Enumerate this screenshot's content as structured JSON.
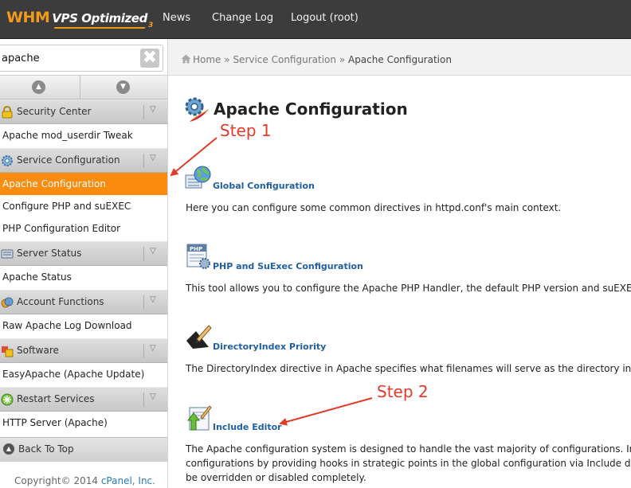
{
  "header": {
    "logo": {
      "whm": "WHM",
      "vps": "VPS Optimized",
      "version": "3"
    },
    "nav": [
      "News",
      "Change Log",
      "Logout (root)"
    ]
  },
  "sidebar": {
    "search_value": "apache",
    "clear_glyph": "✖",
    "groups": [
      {
        "category": "Security Center",
        "icon": "padlock-icon",
        "items": [
          "Apache mod_userdir Tweak"
        ]
      },
      {
        "category": "Service Configuration",
        "icon": "gear-icon",
        "items": [
          "Apache Configuration",
          "Configure PHP and suEXEC",
          "PHP Configuration Editor"
        ]
      },
      {
        "category": "Server Status",
        "icon": "server-icon",
        "items": [
          "Apache Status"
        ]
      },
      {
        "category": "Account Functions",
        "icon": "accounts-icon",
        "items": [
          "Raw Apache Log Download"
        ]
      },
      {
        "category": "Software",
        "icon": "software-icon",
        "items": [
          "EasyApache (Apache Update)"
        ]
      },
      {
        "category": "Restart Services",
        "icon": "restart-icon",
        "items": [
          "HTTP Server (Apache)"
        ]
      }
    ],
    "active_item": "Apache Configuration",
    "back_to_top": "Back To Top",
    "copyright_text": "Copyright© 2014 ",
    "copyright_link": "cPanel, Inc."
  },
  "breadcrumb": {
    "home": "Home",
    "sep": "»",
    "section": "Service Configuration",
    "current": "Apache Configuration"
  },
  "main": {
    "title": "Apache Configuration",
    "sections": [
      {
        "title": "Global Configuration",
        "icon": "globe-config-icon",
        "desc": [
          "Here you can configure some common directives in httpd.conf's main context."
        ]
      },
      {
        "title": "PHP and SuExec Configuration",
        "icon": "php-icon",
        "desc": [
          "This tool allows you to configure the Apache PHP Handler, the default PHP version and suEXEC"
        ]
      },
      {
        "title": "DirectoryIndex Priority",
        "icon": "pen-icon",
        "desc": [
          "The DirectoryIndex directive in Apache specifies what filenames will serve as the directory index p"
        ]
      },
      {
        "title": "Include Editor",
        "icon": "include-editor-icon",
        "desc": [
          "The Apache configuration system is designed to handle the vast majority of configurations. In son",
          "configurations by providing hooks in strategic points in the global configuration via Include directive",
          "be overridden or disabled completely."
        ]
      }
    ]
  },
  "annotations": {
    "step1": "Step 1",
    "step2": "Step 2",
    "color": "#e23b2a"
  },
  "colors": {
    "active": "#f98c0e",
    "link": "#1f5fa3",
    "topbar": "#3c3c3c"
  }
}
